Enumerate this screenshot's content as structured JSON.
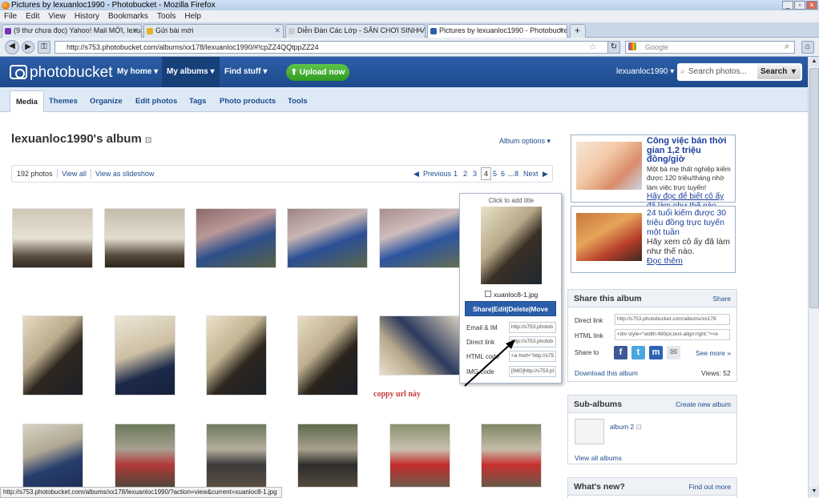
{
  "window": {
    "title": "Pictures by lexuanloc1990 - Photobucket - Mozilla Firefox"
  },
  "menu": [
    "File",
    "Edit",
    "View",
    "History",
    "Bookmarks",
    "Tools",
    "Help"
  ],
  "tabs": [
    {
      "label": "(9 thư chưa đọc) Yahoo! Mail MỚI, lexua..."
    },
    {
      "label": "Gửi bài mới"
    },
    {
      "label": "Diễn Đàn Các Lớp - SÂN CHƠI SINH VIÊN..."
    },
    {
      "label": "Pictures by lexuanloc1990 - Photobucket"
    }
  ],
  "urlbar": {
    "value": "http://s753.photobucket.com/albums/xx178/lexuanloc1990/#!cpZZ4QQtppZZ24"
  },
  "searchbar": {
    "placeholder": "Google"
  },
  "site": {
    "logo": "photobucket",
    "nav": [
      "My home",
      "My albums",
      "Find stuff"
    ],
    "upload": "Upload now",
    "user": "lexuanloc1990",
    "search_placeholder": "Search photos...",
    "search_button": "Search",
    "subnav": [
      "Media",
      "Themes",
      "Organize",
      "Edit photos",
      "Tags",
      "Photo products",
      "Tools"
    ]
  },
  "album": {
    "title": "lexuanloc1990's album",
    "options": "Album options",
    "count": "192 photos",
    "view_all": "View all",
    "slideshow": "View as slideshow",
    "pagination": {
      "previous": "Previous",
      "pages": [
        "1",
        "2",
        "3",
        "4",
        "5",
        "6",
        "...",
        "8"
      ],
      "current": "4",
      "next": "Next"
    }
  },
  "popover": {
    "caption": "Click to add title",
    "filename": "xuanloc8-1.jpg",
    "actions": "Share|Edit|Delete|Move",
    "rows": [
      {
        "label": "Email & IM",
        "value": "http://s753.photob"
      },
      {
        "label": "Direct link",
        "value": "http://s753.photob"
      },
      {
        "label": "HTML code",
        "value": "<a href=\"http://s75"
      },
      {
        "label": "IMG code",
        "value": "[IMG]http://s753.pl"
      }
    ]
  },
  "annotation": "coppy url này",
  "ads": [
    {
      "title": "Công việc bán thời gian 1,2 triệu đồng/giờ",
      "body": "Một bà mẹ thất nghiệp kiếm được 120 triệu/tháng nhờ làm việc trực tuyến!",
      "link": "Hãy đọc để biết cô ấy đã làm như thế nào"
    },
    {
      "title": "24 tuổi kiếm được 30 triệu đồng trực tuyến một tuần",
      "body": "Hãy xem cô ấy đã làm như thế nào.",
      "link": "Đọc thêm"
    }
  ],
  "share": {
    "title": "Share this album",
    "link": "Share",
    "direct_label": "Direct link",
    "direct_value": "http://s753.photobucket.com/albums/xx178",
    "html_label": "HTML link",
    "html_value": "<div style=\"width:480px;text-align:right;\"><e",
    "share_to": "Share to",
    "see_more": "See more",
    "download": "Download this album",
    "views": "Views: 52"
  },
  "subalbums": {
    "title": "Sub-albums",
    "link": "Create new album",
    "item": "album 2",
    "view_all": "View all albums"
  },
  "whatsnew": {
    "title": "What's new?",
    "link": "Find out more"
  },
  "status": "http://s753.photobucket.com/albums/xx178/lexuanloc1990/?action=view&current=xuanloc8-1.jpg"
}
